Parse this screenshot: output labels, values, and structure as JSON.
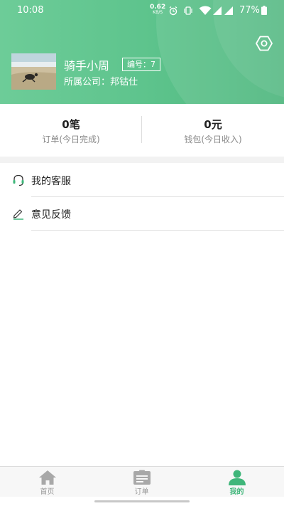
{
  "status_bar": {
    "time": "10:08",
    "net_speed_value": "0.62",
    "net_speed_unit": "KB/S",
    "battery": "77%"
  },
  "profile": {
    "name": "骑手小周",
    "badge": "编号：7",
    "company": "所属公司：邦钴仕"
  },
  "stats": [
    {
      "value": "0笔",
      "label": "订单(今日完成)"
    },
    {
      "value": "0元",
      "label": "钱包(今日收入)"
    }
  ],
  "menu": [
    {
      "label": "我的客服",
      "icon": "headset-icon"
    },
    {
      "label": "意见反馈",
      "icon": "pen-edit-icon"
    }
  ],
  "tabs": [
    {
      "label": "首页",
      "icon": "home-icon",
      "active": false
    },
    {
      "label": "订单",
      "icon": "order-list-icon",
      "active": false
    },
    {
      "label": "我的",
      "icon": "user-icon",
      "active": true
    }
  ],
  "colors": {
    "brand_green": "#5ec48d",
    "active_tab": "#3fb67a",
    "inactive_tab": "#999999"
  }
}
